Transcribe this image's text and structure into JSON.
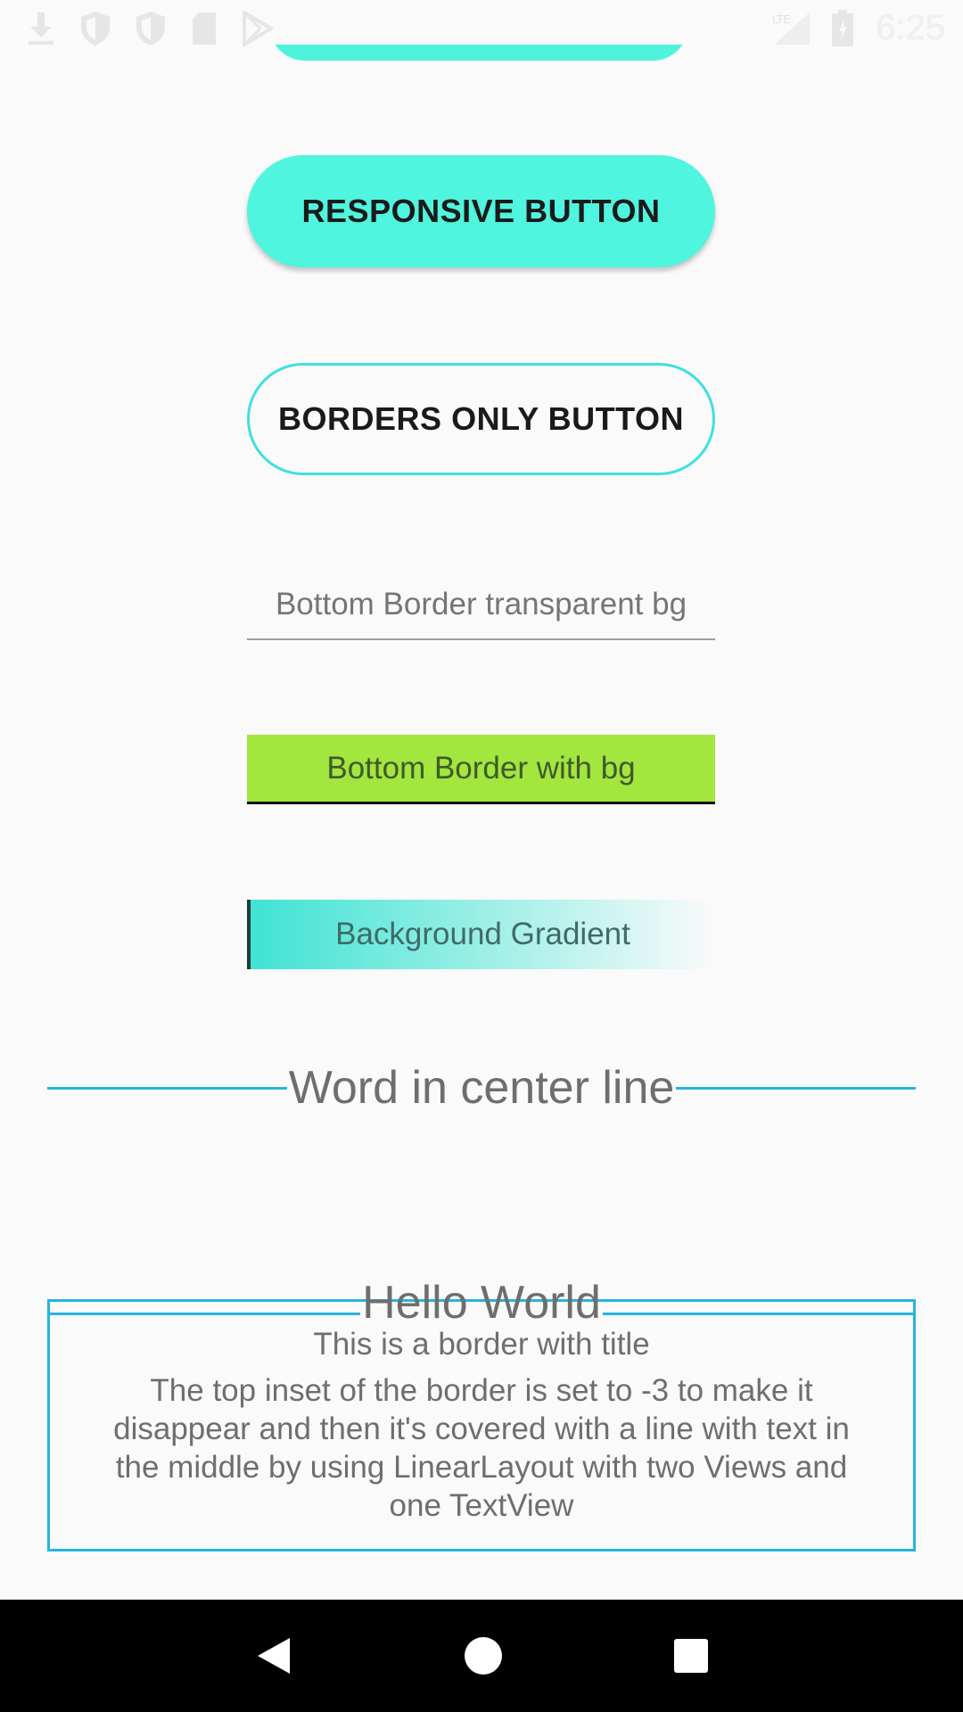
{
  "status_bar": {
    "time": "6:25",
    "left_icons": [
      "download-icon",
      "shield-icon",
      "shield-icon",
      "sd-card-icon",
      "play-store-icon"
    ],
    "right_icons": [
      "lte-signal-icon",
      "battery-icon"
    ]
  },
  "buttons": {
    "responsive_label": "RESPONSIVE BUTTON",
    "borders_only_label": "BORDERS ONLY BUTTON"
  },
  "fields": {
    "bottom_border_transparent": "Bottom Border transparent bg",
    "bottom_border_with_bg": "Bottom Border with bg",
    "background_gradient": "Background Gradient"
  },
  "center_line": {
    "word": "Word in center line"
  },
  "titled_border": {
    "title": "Hello World",
    "subtitle": "This is a border with title",
    "body": "The top inset of the border is set to -3 to make it disappear and then it's covered with a line with text in the middle by using LinearLayout with two Views and one TextView"
  },
  "nav_bar": {
    "icons": [
      "back-icon",
      "home-icon",
      "recents-icon"
    ]
  },
  "colors": {
    "accent_teal": "#4ff5de",
    "accent_blue_line": "#27b3de",
    "lime_bg": "#a2e63e"
  }
}
